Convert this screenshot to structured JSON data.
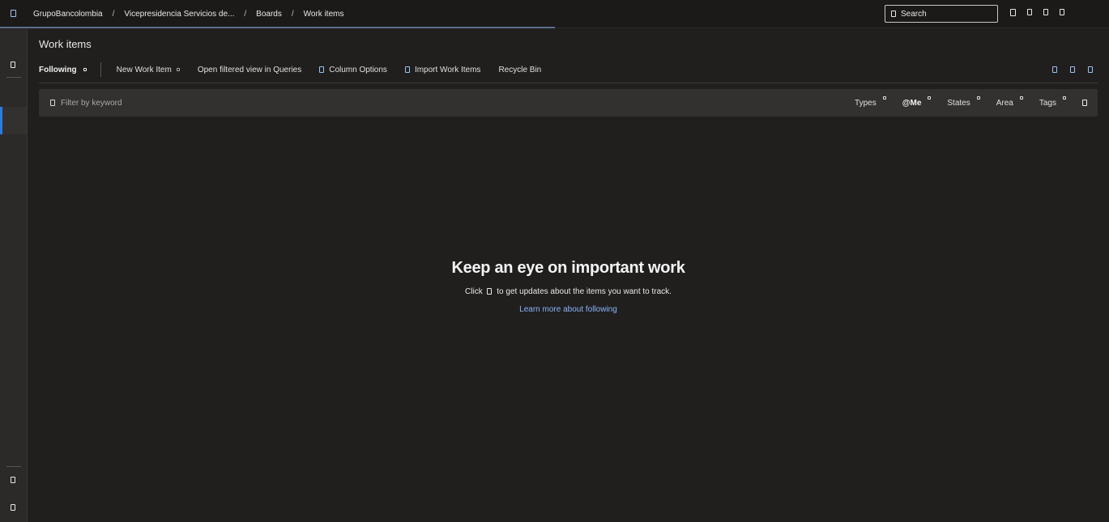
{
  "topbar": {
    "logo_icon": "azure-devops-icon",
    "breadcrumb": [
      "GrupoBancolombia",
      "Vicepresidencia Servicios de...",
      "Boards",
      "Work items"
    ],
    "separator": "/",
    "search_placeholder": "Search",
    "icons": [
      "marketplace-icon",
      "help-icon",
      "settings-icon",
      "user-icon"
    ]
  },
  "sidebar": {
    "top_icon": "boards-icon",
    "bottom_icons": [
      "project-settings-icon",
      "collapse-icon"
    ]
  },
  "page": {
    "title": "Work items"
  },
  "toolbar": {
    "pivot_label": "Following",
    "new_work_item": "New Work Item",
    "open_in_queries": "Open filtered view in Queries",
    "column_options": "Column Options",
    "import_work_items": "Import Work Items",
    "recycle_bin": "Recycle Bin"
  },
  "filter": {
    "placeholder": "Filter by keyword",
    "types": "Types",
    "me": "@Me",
    "states": "States",
    "area": "Area",
    "tags": "Tags"
  },
  "empty_state": {
    "title": "Keep an eye on important work",
    "desc_before": "Click",
    "desc_after": "to get updates about the items you want to track.",
    "link": "Learn more about following"
  },
  "colors": {
    "accent": "#2c7be5",
    "link": "#8ab4f8",
    "background": "#201f1e"
  }
}
